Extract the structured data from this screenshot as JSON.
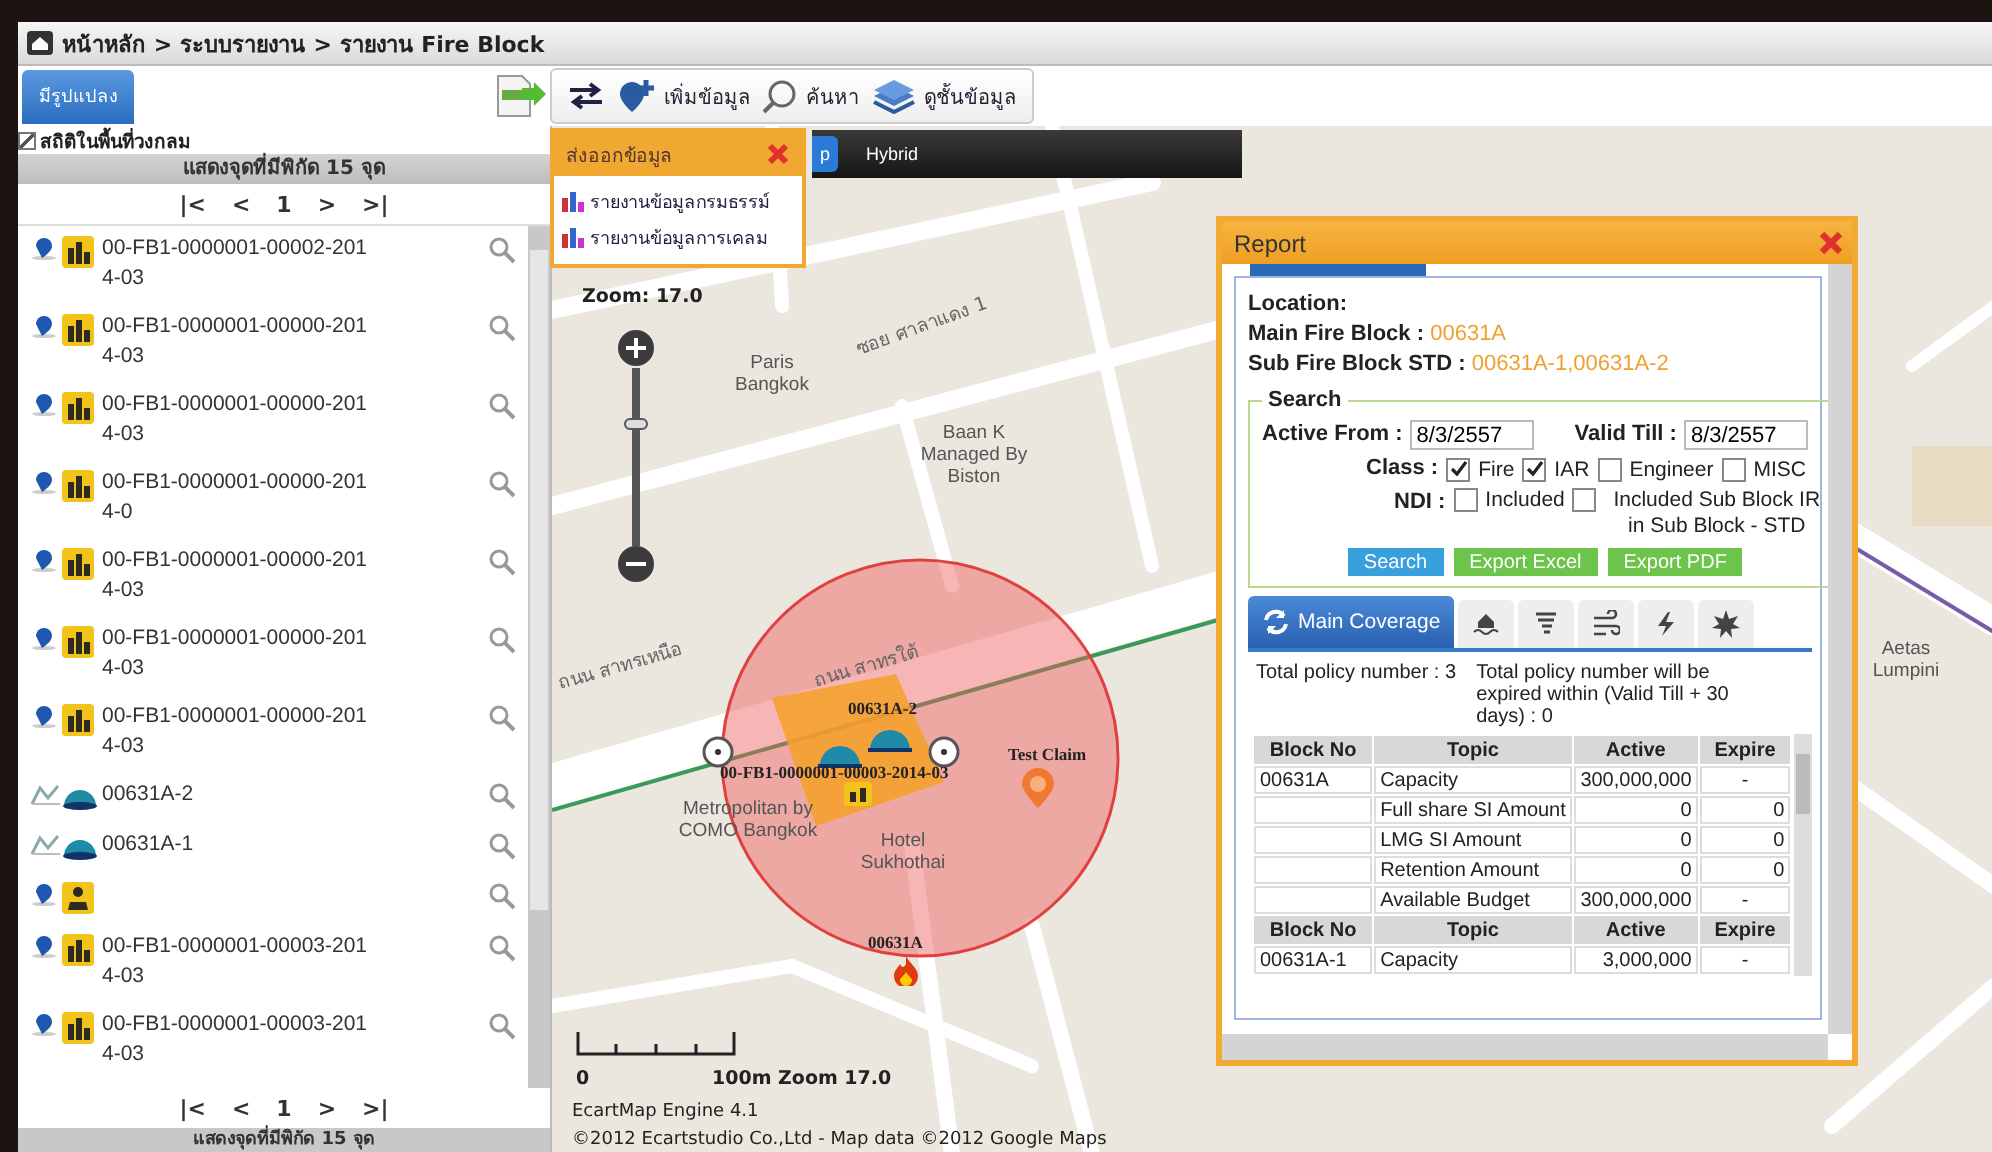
{
  "breadcrumb": "หน้าหลัก > ระบบรายงาน > รายงาน Fire Block",
  "shape_button": "มีรูปแปลง",
  "toolbar": [
    {
      "kind": "export"
    },
    {
      "kind": "swap"
    },
    {
      "kind": "add",
      "label": "เพิ่มข้อมูล"
    },
    {
      "kind": "search",
      "label": "ค้นหา"
    },
    {
      "kind": "layers",
      "label": "ดูชั้นข้อมูล"
    }
  ],
  "sidebar": {
    "circle_stats": {
      "label": "สถิติในพื้นที่วงกลม",
      "checked": true
    },
    "header": "แสดงจุดที่มีพิกัด 15 จุด",
    "pager": [
      "|<",
      "<",
      "1",
      ">",
      ">|"
    ],
    "items": [
      {
        "kind": "policy",
        "label": "00-FB1-0000001-00002-2014-03"
      },
      {
        "kind": "policy",
        "label": "00-FB1-0000001-00000-2014-03"
      },
      {
        "kind": "policy",
        "label": "00-FB1-0000001-00000-2014-03"
      },
      {
        "kind": "policy",
        "label": "00-FB1-0000001-00000-2014-0"
      },
      {
        "kind": "policy",
        "label": "00-FB1-0000001-00000-2014-03"
      },
      {
        "kind": "policy",
        "label": "00-FB1-0000001-00000-2014-03"
      },
      {
        "kind": "policy",
        "label": "00-FB1-0000001-00000-2014-03"
      },
      {
        "kind": "block",
        "label": "00631A-2"
      },
      {
        "kind": "block",
        "label": "00631A-1"
      },
      {
        "kind": "claim"
      },
      {
        "kind": "policy",
        "label": "00-FB1-0000001-00003-2014-03"
      },
      {
        "kind": "policy",
        "label": "00-FB1-0000001-00003-2014-03"
      }
    ],
    "footer_pager": [
      "|<",
      "<",
      "1",
      ">",
      ">|"
    ],
    "footer": "แสดงจุดที่มีพิกัด 15 จุด"
  },
  "export_popup": {
    "title": "ส่งออกข้อมูล",
    "items": [
      "รายงานข้อมูลกรมธรรม์",
      "รายงานข้อมูลการเคลม"
    ]
  },
  "map": {
    "types": [
      {
        "label": "p",
        "selected": true
      },
      {
        "label": "Hybrid",
        "selected": false
      }
    ],
    "zoom_label": "Zoom: 17.0",
    "zoom_slider": {
      "level": 0.7
    },
    "labels": [
      {
        "kind": "place",
        "text": "Paris Bangkok"
      },
      {
        "kind": "place",
        "text": "Baan K Managed By Biston"
      },
      {
        "kind": "place",
        "text": "Metropolitan by COMO Bangkok"
      },
      {
        "kind": "place",
        "text": "Hotel Sukhothai"
      },
      {
        "kind": "place",
        "text": "Aetas Lumpini"
      },
      {
        "kind": "street",
        "text": "ซอย ศาลาแดง 1"
      },
      {
        "kind": "street",
        "text": "ถนน สาทรเหนือ"
      },
      {
        "kind": "street",
        "text": "ถนน สาทรใต้"
      }
    ],
    "markers": [
      {
        "kind": "block",
        "text": "00631A-2"
      },
      {
        "kind": "policy",
        "text": "00-FB1-0000001-00003-2014-03"
      },
      {
        "kind": "claim",
        "text": "Test Claim"
      },
      {
        "kind": "fire",
        "text": "00631A"
      }
    ],
    "scale": {
      "start": "0",
      "end": "100m Zoom 17.0"
    },
    "engine": "EcartMap Engine 4.1",
    "copyright": "©2012 Ecartstudio Co.,Ltd - Map data ©2012 Google Maps"
  },
  "report": {
    "title": "Report",
    "location_label": "Location:",
    "main_block": {
      "label": "Main Fire Block :",
      "value": "00631A"
    },
    "sub_block": {
      "label": "Sub Fire Block STD :",
      "value": "00631A-1,00631A-2"
    },
    "search": {
      "legend": "Search",
      "active_from": {
        "label": "Active From :",
        "value": "8/3/2557"
      },
      "valid_till": {
        "label": "Valid Till :",
        "value": "8/3/2557"
      },
      "class_label": "Class :",
      "classes": [
        {
          "label": "Fire",
          "checked": true
        },
        {
          "label": "IAR",
          "checked": true
        },
        {
          "label": "Engineer",
          "checked": false
        },
        {
          "label": "MISC",
          "checked": false
        }
      ],
      "ndi_label": "NDI :",
      "ndi": [
        {
          "label": "Included",
          "checked": false
        },
        {
          "label": "Included Sub Block IR in Sub Block - STD",
          "checked": false
        }
      ],
      "buttons": [
        {
          "kind": "search",
          "label": "Search"
        },
        {
          "kind": "export",
          "label": "Export Excel"
        },
        {
          "kind": "export",
          "label": "Export PDF"
        }
      ]
    },
    "tabs": [
      {
        "kind": "coverage",
        "label": "Main Coverage",
        "selected": true
      },
      {
        "kind": "flood",
        "selected": false
      },
      {
        "kind": "storm",
        "selected": false
      },
      {
        "kind": "wind",
        "selected": false
      },
      {
        "kind": "lightning",
        "selected": false
      },
      {
        "kind": "explosion",
        "selected": false
      }
    ],
    "total": "Total policy number : 3",
    "expiring": "Total policy number will be expired within (Valid Till + 30 days) : 0",
    "table": {
      "columns": [
        "Block No",
        "Topic",
        "Active",
        "Expire"
      ],
      "rows": [
        {
          "kind": "data",
          "block_no": "00631A",
          "topic": "Capacity",
          "active": "300,000,000",
          "expire": "-"
        },
        {
          "kind": "data",
          "topic": "Full share SI Amount",
          "active": "0",
          "expire": "0"
        },
        {
          "kind": "data",
          "topic": "LMG SI Amount",
          "active": "0",
          "expire": "0"
        },
        {
          "kind": "data",
          "topic": "Retention Amount",
          "active": "0",
          "expire": "0"
        },
        {
          "kind": "data",
          "topic": "Available Budget",
          "active": "300,000,000",
          "expire": "-"
        },
        {
          "kind": "header",
          "cells": [
            "Block No",
            "Topic",
            "Active",
            "Expire"
          ]
        },
        {
          "kind": "data",
          "block_no": "00631A-1",
          "topic": "Capacity",
          "active": "3,000,000",
          "expire": "-"
        }
      ]
    }
  }
}
